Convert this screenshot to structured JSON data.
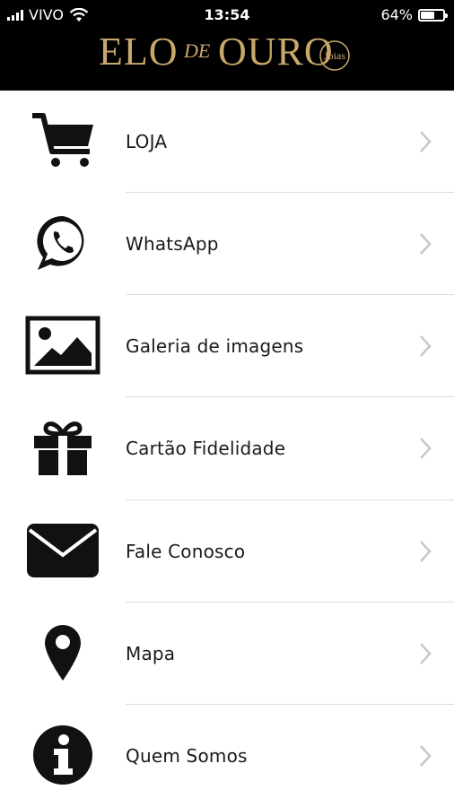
{
  "status_bar": {
    "carrier": "VIVO",
    "time": "13:54",
    "battery_percent_label": "64%",
    "battery_level": 0.64,
    "icons": [
      "signal-bars-icon",
      "wifi-icon",
      "battery-icon"
    ]
  },
  "brand": {
    "logo_main": "ELO",
    "logo_mid": "DE",
    "logo_end": "OURO",
    "logo_sub": "Joias",
    "gold_color": "#c8a96b"
  },
  "menu": {
    "items": [
      {
        "label": "LOJA",
        "icon": "cart-icon"
      },
      {
        "label": "WhatsApp",
        "icon": "whatsapp-icon"
      },
      {
        "label": "Galeria de imagens",
        "icon": "image-gallery-icon"
      },
      {
        "label": "Cartão Fidelidade",
        "icon": "gift-icon"
      },
      {
        "label": "Fale Conosco",
        "icon": "envelope-icon"
      },
      {
        "label": "Mapa",
        "icon": "map-pin-icon"
      },
      {
        "label": "Quem Somos",
        "icon": "info-icon"
      }
    ]
  }
}
